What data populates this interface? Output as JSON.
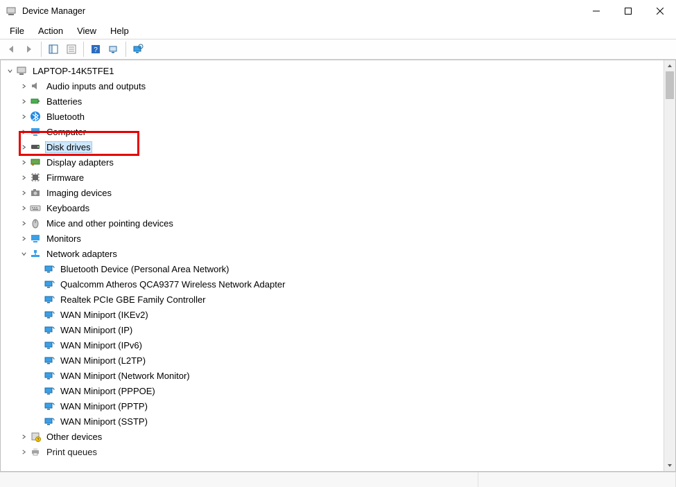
{
  "window": {
    "title": "Device Manager"
  },
  "menu": {
    "file": "File",
    "action": "Action",
    "view": "View",
    "help": "Help"
  },
  "tree": {
    "root": "LAPTOP-14K5TFE1",
    "categories": {
      "audio": "Audio inputs and outputs",
      "batteries": "Batteries",
      "bluetooth": "Bluetooth",
      "computer": "Computer",
      "disk": "Disk drives",
      "display": "Display adapters",
      "firmware": "Firmware",
      "imaging": "Imaging devices",
      "keyboards": "Keyboards",
      "mice": "Mice and other pointing devices",
      "monitors": "Monitors",
      "network": "Network adapters",
      "other": "Other devices",
      "print": "Print queues"
    },
    "network_children": [
      "Bluetooth Device (Personal Area Network)",
      "Qualcomm Atheros QCA9377 Wireless Network Adapter",
      "Realtek PCIe GBE Family Controller",
      "WAN Miniport (IKEv2)",
      "WAN Miniport (IP)",
      "WAN Miniport (IPv6)",
      "WAN Miniport (L2TP)",
      "WAN Miniport (Network Monitor)",
      "WAN Miniport (PPPOE)",
      "WAN Miniport (PPTP)",
      "WAN Miniport (SSTP)"
    ]
  }
}
